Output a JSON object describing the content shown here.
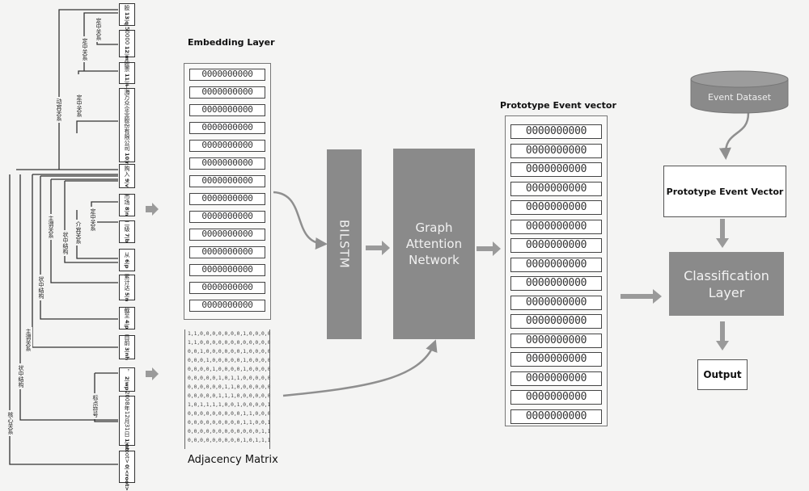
{
  "parse_tree": {
    "tokens": [
      {
        "word": "股",
        "index": "13",
        "pos": "q"
      },
      {
        "word": "50000",
        "index": "12",
        "pos": "m"
      },
      {
        "word": "股票",
        "index": "11",
        "pos": "n"
      },
      {
        "word": "上海万众企业股份有限公司",
        "index": "10",
        "pos": "ni"
      },
      {
        "word": "购入",
        "index": "9",
        "pos": "v"
      },
      {
        "word": "市场",
        "index": "8",
        "pos": "n"
      },
      {
        "word": "二级",
        "index": "7",
        "pos": "b"
      },
      {
        "word": "从",
        "index": "6",
        "pos": "p"
      },
      {
        "word": "累计达",
        "index": "5",
        "pos": "n"
      },
      {
        "word": "截至",
        "index": "4",
        "pos": "p"
      },
      {
        "word": "目前",
        "index": "3",
        "pos": "nh"
      },
      {
        "word": "，",
        "index": "2",
        "pos": "wp"
      },
      {
        "word": "2008年12月31日",
        "index": "1",
        "pos": "nt"
      },
      {
        "word": "<root>",
        "index": "0",
        "pos": "<root>"
      }
    ],
    "arc_labels": [
      "动宾关系",
      "定中关系",
      "定中关系",
      "定中关系",
      "主谓关系",
      "介宾关系",
      "定中关系",
      "状中结构",
      "状中结构",
      "主谓关系",
      "状中结构",
      "标点符号",
      "核心关系"
    ]
  },
  "embedding": {
    "title": "Embedding Layer",
    "rows": [
      "0000000000",
      "0000000000",
      "0000000000",
      "0000000000",
      "0000000000",
      "0000000000",
      "0000000000",
      "0000000000",
      "0000000000",
      "0000000000",
      "0000000000",
      "0000000000",
      "0000000000",
      "0000000000"
    ]
  },
  "adjacency": {
    "title": "Adjacency Matrix",
    "rows": [
      "1,1,0,0,0,0,0,0,0,1,0,0,0,0",
      "1,1,0,0,0,0,0,0,0,0,0,0,0,0",
      "0,0,1,0,0,0,0,0,0,1,0,0,0,0",
      "0,0,0,1,0,0,0,0,0,1,0,0,0,0",
      "0,0,0,0,1,0,0,0,0,1,0,0,0,0",
      "0,0,0,0,0,1,0,1,1,0,0,0,0,0",
      "0,0,0,0,0,0,1,1,0,0,0,0,0,0",
      "0,0,0,0,0,1,1,1,0,0,0,0,0,0",
      "1,0,1,1,1,1,0,0,1,0,0,0,0,1",
      "0,0,0,0,0,0,0,0,0,1,1,0,0,0",
      "0,0,0,0,0,0,0,0,0,1,1,0,0,1",
      "0,0,0,0,0,0,0,0,0,0,0,0,1,1",
      "0,0,0,0,0,0,0,0,0,1,0,1,1,1"
    ]
  },
  "bilstm": {
    "label": "BILSTM"
  },
  "gat": {
    "label": "Graph Attention Network"
  },
  "prototype_vector": {
    "title": "Prototype Event vector",
    "rows": [
      "0000000000",
      "0000000000",
      "0000000000",
      "0000000000",
      "0000000000",
      "0000000000",
      "0000000000",
      "0000000000",
      "0000000000",
      "0000000000",
      "0000000000",
      "0000000000",
      "0000000000",
      "0000000000",
      "0000000000",
      "0000000000"
    ]
  },
  "event_dataset": {
    "label": "Event Dataset"
  },
  "prototype_box": {
    "label": "Prototype Event Vector"
  },
  "classification": {
    "label": "Classification Layer"
  },
  "output": {
    "label": "Output"
  },
  "colors": {
    "block": "#8a8a8a",
    "arrow": "#8f8f8f",
    "line": "#333333"
  }
}
